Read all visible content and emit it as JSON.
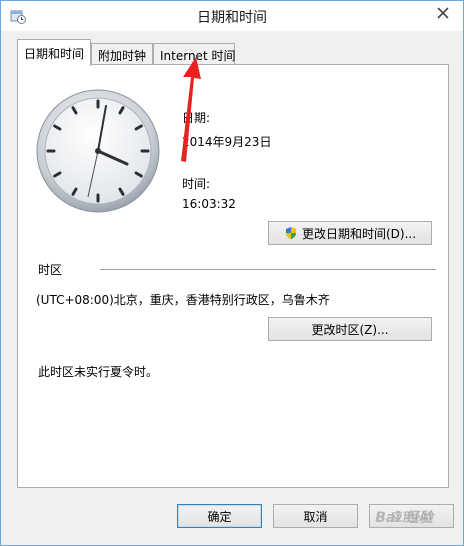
{
  "window": {
    "title": "日期和时间"
  },
  "tabs": [
    {
      "label": "日期和时间",
      "active": true
    },
    {
      "label": "附加时钟",
      "active": false
    },
    {
      "label": "Internet 时间",
      "active": false
    }
  ],
  "date_section": {
    "label": "日期:",
    "value": "2014年9月23日"
  },
  "time_section": {
    "label": "时间:",
    "value": "16:03:32"
  },
  "change_datetime_button": "更改日期和时间(D)...",
  "timezone": {
    "label": "时区",
    "value": "(UTC+08:00)北京，重庆，香港特别行政区，乌鲁木齐",
    "change_button": "更改时区(Z)...",
    "dst_note": "此时区未实行夏令时。"
  },
  "footer": {
    "ok": "确定",
    "cancel": "取消",
    "apply": "应用(A)"
  },
  "watermark": "Bai 经验",
  "colors": {
    "annotation_arrow": "#e8221f",
    "accent_border": "#3c7fb1"
  },
  "icons": [
    "calendar-clock-icon",
    "close-icon",
    "shield-icon",
    "analog-clock-icon"
  ]
}
